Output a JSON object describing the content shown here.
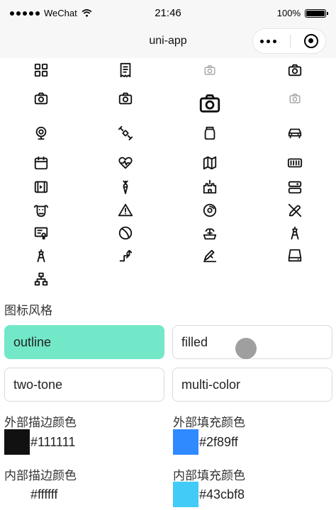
{
  "status_bar": {
    "carrier": "WeChat",
    "time": "21:46",
    "battery": "100%",
    "battery_level": 1.0
  },
  "nav": {
    "title": "uni-app"
  },
  "icons": [
    "grid-icon",
    "receipt-icon",
    "camera-icon-disabled",
    "camera-icon",
    "camera-icon",
    "camera-icon",
    "camera-large-icon",
    "camera-icon-disabled",
    "webcam-icon",
    "satellite-icon",
    "jar-icon",
    "car-icon",
    "calendar-icon",
    "heart-rate-icon",
    "map-icon",
    "battery-cells-icon",
    "video-play-icon",
    "carrot-icon",
    "castle-icon",
    "toggle-settings-icon",
    "cow-icon",
    "warning-icon",
    "disc-icon",
    "no-pencil-icon",
    "certificate-icon",
    "ban-icon",
    "fountain-icon",
    "tower-icon",
    "tower-icon",
    "transfer-arrows-icon",
    "sign-icon",
    "hard-drive-icon",
    "network-hierarchy-icon"
  ],
  "icon_style": {
    "title": "图标风格",
    "options": [
      "outline",
      "filled",
      "two-tone",
      "multi-color"
    ],
    "selected": "outline"
  },
  "colors": {
    "outer_stroke": {
      "label": "外部描边颜色",
      "value": "#111111"
    },
    "outer_fill": {
      "label": "外部填充颜色",
      "value": "#2f89ff"
    },
    "inner_stroke": {
      "label": "内部描边颜色",
      "value": "#ffffff"
    },
    "inner_fill": {
      "label": "内部填充颜色",
      "value": "#43cbf8"
    }
  }
}
